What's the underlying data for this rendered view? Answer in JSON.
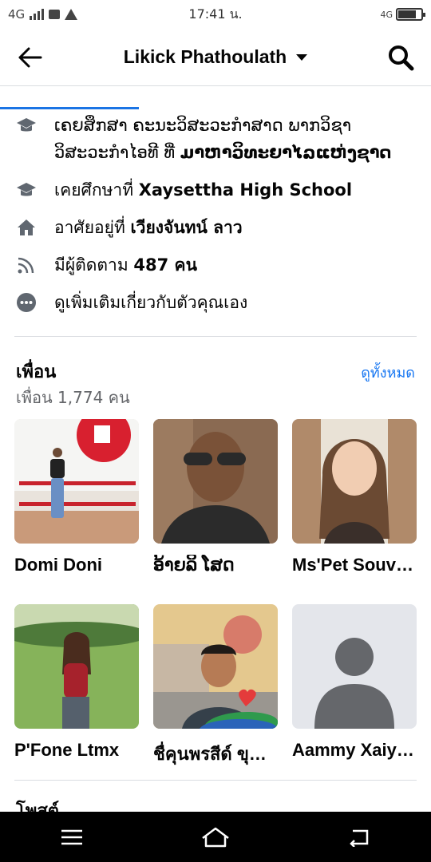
{
  "status_bar": {
    "network": "4G",
    "time": "17:41 น.",
    "right_network": "4G",
    "battery_level": 0.7
  },
  "nav": {
    "title": "Likick Phathoulath",
    "icons": [
      "back-arrow-icon",
      "chevron-down-icon",
      "search-icon"
    ]
  },
  "intro": [
    {
      "icon": "graduation-cap-icon",
      "prefix": "ເຄຍສຶກສາ ຄະນະວິສະວະກຳສາດ ພາກວິຊາວິສະວະກຳໄອທີ ທີ່ ",
      "bold": "ມາຫາວິທະຍາໄລແຫ່ງຊາດ"
    },
    {
      "icon": "graduation-cap-icon",
      "prefix": "เคยศึกษาที่ ",
      "bold": "Xaysettha High School"
    },
    {
      "icon": "home-icon",
      "prefix": "อาศัยอยู่ที่ ",
      "bold": "เวียงจันทน์ ลาว"
    },
    {
      "icon": "rss-followers-icon",
      "prefix": "มีผู้ติดตาม ",
      "bold": "487 คน"
    },
    {
      "icon": "more-dots-icon",
      "prefix": "ดูเพิ่มเติมเกี่ยวกับตัวคุณเอง",
      "bold": ""
    }
  ],
  "friends": {
    "title": "เพื่อน",
    "see_all": "ดูทั้งหมด",
    "count": "เพื่อน 1,774 คน",
    "list": [
      {
        "name": "Domi Doni"
      },
      {
        "name": "ອ້າຍລິ ໂສດ"
      },
      {
        "name": "Ms'Pet Souvanh"
      },
      {
        "name": "P'Fone Ltmx"
      },
      {
        "name": "ชื่คุนพรสีด์ ขุนพรมสีด์"
      },
      {
        "name": "Aammy Xaiyavong"
      }
    ]
  },
  "posts": {
    "label": "โพสต์"
  },
  "colors": {
    "accent": "#1877f2",
    "text": "#050505",
    "secondary_text": "#65676b",
    "divider": "#dadde1"
  }
}
